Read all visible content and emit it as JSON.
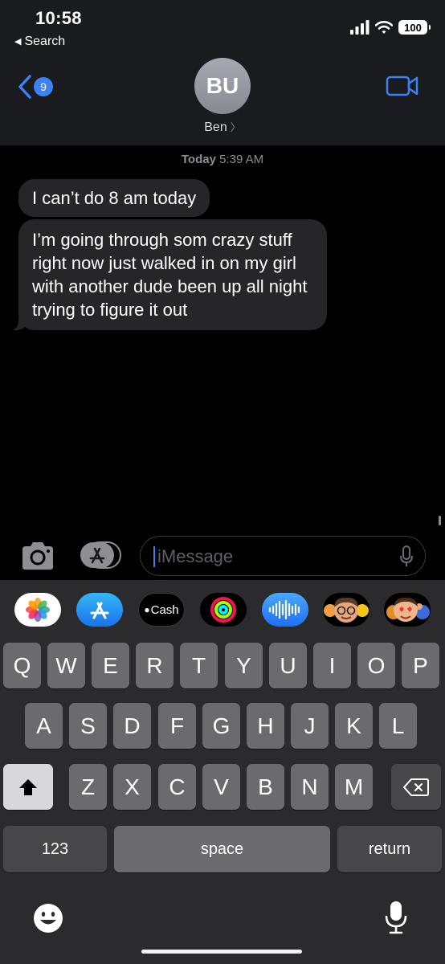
{
  "status_bar": {
    "time": "10:58",
    "back_app": "Search",
    "battery": "100"
  },
  "header": {
    "back_badge": "9",
    "avatar_initials": "BU",
    "contact_name": "Ben"
  },
  "conversation": {
    "timestamp_day": "Today",
    "timestamp_time": "5:39 AM",
    "messages": [
      "I can’t do 8 am today",
      "I’m going through som crazy stuff right now just walked in on my girl with another dude been up all night trying to figure it out"
    ]
  },
  "composer": {
    "placeholder": "iMessage"
  },
  "app_drawer": {
    "apps": [
      "photos-icon",
      "app-store-icon",
      "cash-icon",
      "activity-icon",
      "audio-message-icon",
      "memoji-icon",
      "memoji-stickers-icon"
    ],
    "cash_label": "Cash"
  },
  "keyboard": {
    "row1": [
      "Q",
      "W",
      "E",
      "R",
      "T",
      "Y",
      "U",
      "I",
      "O",
      "P"
    ],
    "row2": [
      "A",
      "S",
      "D",
      "F",
      "G",
      "H",
      "J",
      "K",
      "L"
    ],
    "row3": [
      "Z",
      "X",
      "C",
      "V",
      "B",
      "N",
      "M"
    ],
    "numbers_label": "123",
    "space_label": "space",
    "return_label": "return"
  },
  "colors": {
    "accent": "#3b82f6",
    "bubble": "#262628",
    "keyboard_bg": "#2b2b2d",
    "key": "#6b6b6f",
    "key_dark": "#47474a"
  }
}
